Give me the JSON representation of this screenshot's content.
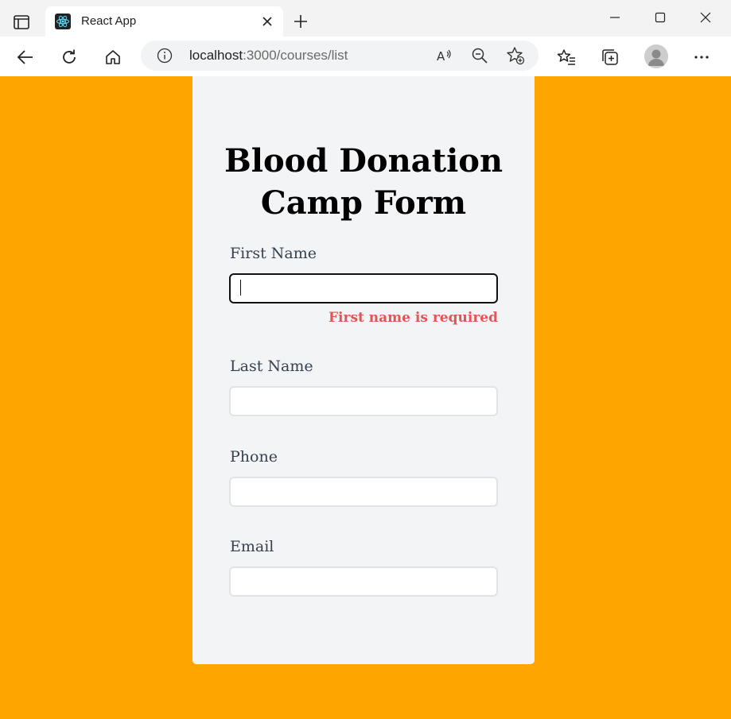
{
  "browser": {
    "tab_title": "React App",
    "url_host": "localhost",
    "url_path": ":3000/courses/list",
    "icons": {
      "sidebar": "sidebar-icon",
      "favicon": "react-logo-icon",
      "tab_close": "close-icon",
      "new_tab": "plus-icon",
      "back": "back-arrow-icon",
      "refresh": "refresh-icon",
      "home": "home-icon",
      "info": "info-icon",
      "read_aloud": "read-aloud-icon",
      "zoom": "zoom-out-icon",
      "favorite": "add-favorite-icon",
      "favorites": "favorites-icon",
      "collections": "collections-icon",
      "profile": "profile-avatar-icon",
      "more": "more-icon"
    }
  },
  "form": {
    "title_line1": "Blood Donation",
    "title_line2": "Camp Form",
    "fields": [
      {
        "label": "First Name",
        "value": "",
        "error": "First name is required"
      },
      {
        "label": "Last Name",
        "value": ""
      },
      {
        "label": "Phone",
        "value": ""
      },
      {
        "label": "Email",
        "value": ""
      }
    ]
  },
  "colors": {
    "page_background": "#ffa500",
    "card_background": "#f3f4f6",
    "label_text": "#374151",
    "error_text": "#e05656"
  }
}
